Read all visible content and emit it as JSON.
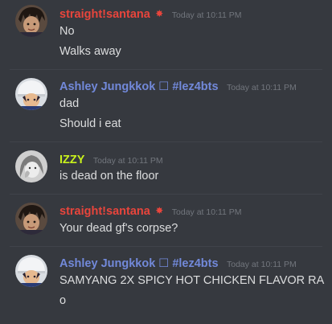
{
  "colors": {
    "background": "#36393f",
    "text": "#dcddde",
    "timestamp": "#72767d",
    "santana": "#e8453c",
    "ashley": "#7289da",
    "izzy": "#c9f11c"
  },
  "messages": [
    {
      "author": "straight!santana",
      "badge_icon": "burst-icon",
      "badge": "✸",
      "timestamp": "Today at 10:11 PM",
      "lines": [
        "No",
        "Walks away"
      ]
    },
    {
      "author": "Ashley Jungkkok ☐ #lez4bts",
      "timestamp": "Today at 10:11 PM",
      "lines": [
        "dad",
        "Should i eat"
      ]
    },
    {
      "author": "IZZY",
      "timestamp": "Today at 10:11 PM",
      "lines": [
        "is dead on the floor"
      ]
    },
    {
      "author": "straight!santana",
      "badge_icon": "burst-icon",
      "badge": "✸",
      "timestamp": "Today at 10:11 PM",
      "lines": [
        "Your dead gf's corpse?"
      ]
    },
    {
      "author": "Ashley Jungkkok ☐ #lez4bts",
      "timestamp": "Today at 10:11 PM",
      "lines": [
        "SAMYANG 2X SPICY HOT CHICKEN FLAVOR RA",
        "o"
      ]
    }
  ]
}
